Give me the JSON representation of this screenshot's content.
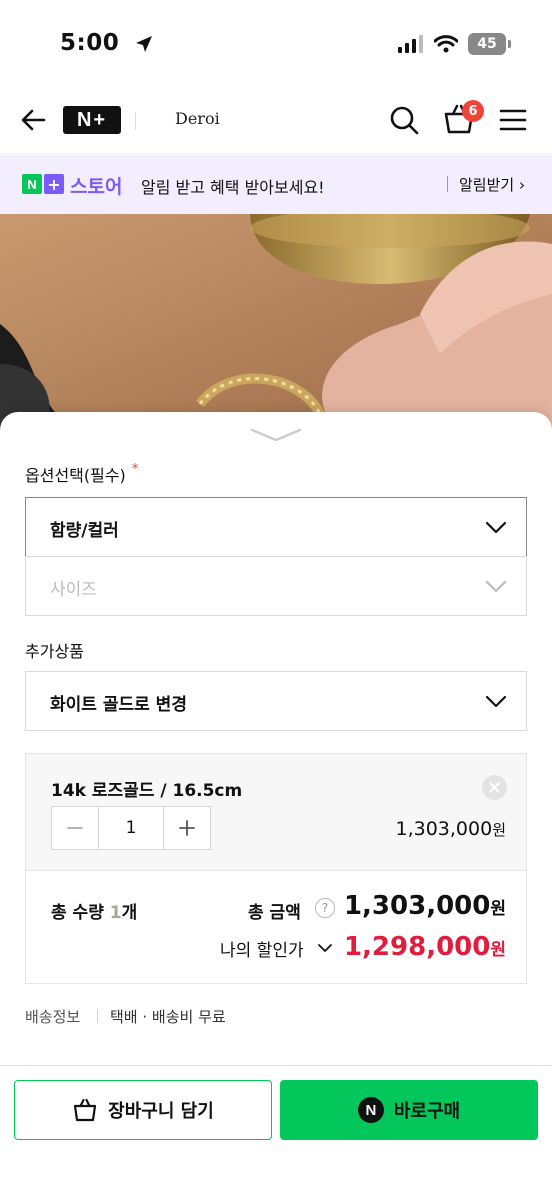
{
  "status_bar": {
    "time": "5:00",
    "battery": "45"
  },
  "header": {
    "logo": "N+",
    "brand": "Deroi",
    "cart_count": "6"
  },
  "promo": {
    "n": "N",
    "plus": "+",
    "store": "스토어",
    "text": "알림 받고 혜택 받아보세요!",
    "action": "알림받기 ›"
  },
  "options": {
    "section_label": "옵션선택(필수)",
    "required_mark": "*",
    "select1": "함량/컬러",
    "select2": "사이즈",
    "addon_label": "추가상품",
    "addon_select": "화이트 골드로 변경"
  },
  "selected_option": {
    "name": "14k 로즈골드 / 16.5cm",
    "quantity": "1",
    "price": "1,303,000",
    "currency": "원"
  },
  "totals": {
    "qty_label": "총 수량",
    "qty_value": "1",
    "qty_unit": "개",
    "amount_label": "총 금액",
    "help": "?",
    "amount": "1,303,000",
    "currency": "원",
    "discount_label": "나의 할인가",
    "discount_price": "1,298,000"
  },
  "shipping": {
    "label": "배송정보",
    "info": "택배 · 배송비 무료"
  },
  "actions": {
    "cart": "장바구니 담기",
    "npay": "N",
    "buy": "바로구매"
  },
  "colors": {
    "naver_green": "#03c75a",
    "plus_purple": "#7a5af8",
    "discount_red": "#e31b3c",
    "badge_red": "#f04438"
  }
}
